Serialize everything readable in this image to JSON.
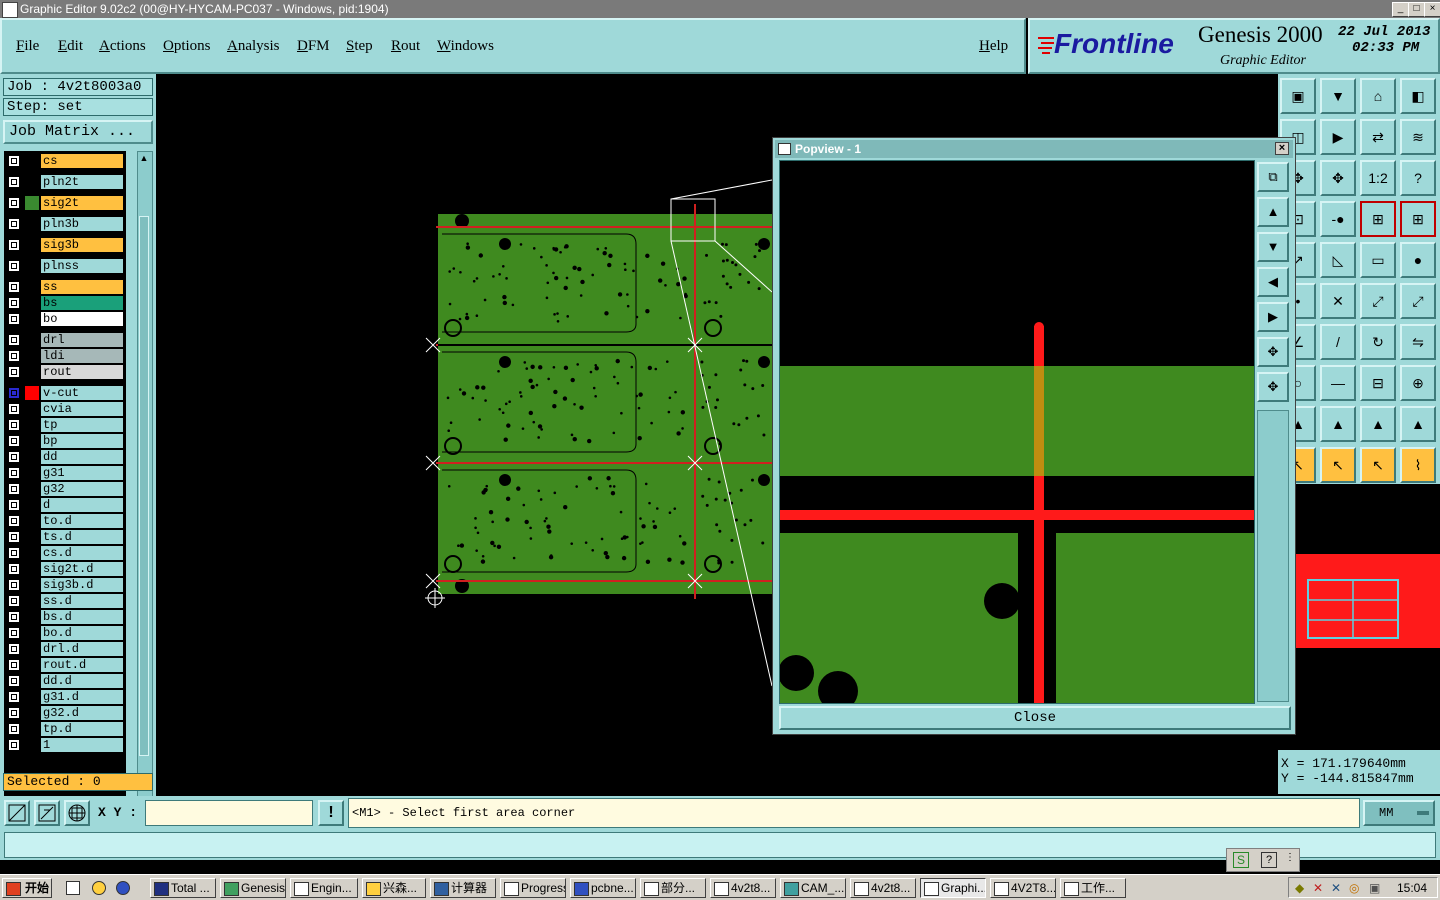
{
  "window": {
    "title": "Graphic Editor 9.02c2 (00@HY-HYCAM-PC037 - Windows, pid:1904)"
  },
  "menubar": {
    "items": [
      "File",
      "Edit",
      "Actions",
      "Options",
      "Analysis",
      "DFM",
      "Step",
      "Rout",
      "Windows"
    ],
    "help": "Help"
  },
  "brand": {
    "logo": "Frontline",
    "product": "Genesis 2000",
    "subtitle": "Graphic Editor",
    "date": "22 Jul 2013",
    "time": "02:33 PM"
  },
  "left_panel": {
    "job": "Job : 4v2t8003a0",
    "step": "Step: set",
    "job_matrix": "Job Matrix ...",
    "selected": "Selected : 0",
    "layers": [
      {
        "name": "cs",
        "color": "#ffc040",
        "swatch": ""
      },
      {
        "name": "pln2t",
        "color": "#9fd9d9",
        "swatch": ""
      },
      {
        "name": "sig2t",
        "color": "#ffc040",
        "swatch": "#3a8a30"
      },
      {
        "name": "pln3b",
        "color": "#9fd9d9",
        "swatch": ""
      },
      {
        "name": "sig3b",
        "color": "#ffc040",
        "swatch": ""
      },
      {
        "name": "plnss",
        "color": "#9fd9d9",
        "swatch": ""
      },
      {
        "name": "ss",
        "color": "#ffc040",
        "swatch": ""
      },
      {
        "name": "bs",
        "color": "#1aa07a",
        "swatch": ""
      },
      {
        "name": "bo",
        "color": "#ffffff",
        "swatch": ""
      },
      {
        "name": "drl",
        "color": "#a6b8b8",
        "swatch": ""
      },
      {
        "name": "ldi",
        "color": "#a6b8b8",
        "swatch": ""
      },
      {
        "name": "rout",
        "color": "#d8d8d8",
        "swatch": ""
      },
      {
        "name": "v-cut",
        "color": "#9fd9d9",
        "swatch": "#ff0000"
      },
      {
        "name": "cvia",
        "color": "#9fd9d9",
        "swatch": ""
      },
      {
        "name": "tp",
        "color": "#9fd9d9",
        "swatch": ""
      },
      {
        "name": "bp",
        "color": "#9fd9d9",
        "swatch": ""
      },
      {
        "name": "dd",
        "color": "#9fd9d9",
        "swatch": ""
      },
      {
        "name": "g31",
        "color": "#9fd9d9",
        "swatch": ""
      },
      {
        "name": "g32",
        "color": "#9fd9d9",
        "swatch": ""
      },
      {
        "name": "d",
        "color": "#9fd9d9",
        "swatch": ""
      },
      {
        "name": "to.d",
        "color": "#9fd9d9",
        "swatch": ""
      },
      {
        "name": "ts.d",
        "color": "#9fd9d9",
        "swatch": ""
      },
      {
        "name": "cs.d",
        "color": "#9fd9d9",
        "swatch": ""
      },
      {
        "name": "sig2t.d",
        "color": "#9fd9d9",
        "swatch": ""
      },
      {
        "name": "sig3b.d",
        "color": "#9fd9d9",
        "swatch": ""
      },
      {
        "name": "ss.d",
        "color": "#9fd9d9",
        "swatch": ""
      },
      {
        "name": "bs.d",
        "color": "#9fd9d9",
        "swatch": ""
      },
      {
        "name": "bo.d",
        "color": "#9fd9d9",
        "swatch": ""
      },
      {
        "name": "drl.d",
        "color": "#9fd9d9",
        "swatch": ""
      },
      {
        "name": "rout.d",
        "color": "#9fd9d9",
        "swatch": ""
      },
      {
        "name": "dd.d",
        "color": "#9fd9d9",
        "swatch": ""
      },
      {
        "name": "g31.d",
        "color": "#9fd9d9",
        "swatch": ""
      },
      {
        "name": "g32.d",
        "color": "#9fd9d9",
        "swatch": ""
      },
      {
        "name": "tp.d",
        "color": "#9fd9d9",
        "swatch": ""
      },
      {
        "name": "1",
        "color": "#9fd9d9",
        "swatch": ""
      }
    ]
  },
  "popview": {
    "title": "Popview - 1",
    "close_label": "Close"
  },
  "coords": {
    "x": "X = 171.179640mm",
    "y": "Y = -144.815847mm"
  },
  "command": {
    "xy_label": "X Y :",
    "xy_value": "",
    "prompt": "<M1> - Select first area corner",
    "units": "MM"
  },
  "taskbar": {
    "start": "开始",
    "clock": "15:04",
    "tasks": [
      "Total ...",
      "Genesis",
      "Engin...",
      "兴森...",
      "计算器",
      "Progress",
      "pcbne...",
      "部分...",
      "4v2t8...",
      "CAM_...",
      "4v2t8...",
      "Graphi...",
      "4V2T8...",
      "工作..."
    ]
  },
  "colors": {
    "panel": "#9fd9d9",
    "board": "#3f8a1f",
    "vcut": "#ff1a1a",
    "highlight": "#ffc040"
  }
}
